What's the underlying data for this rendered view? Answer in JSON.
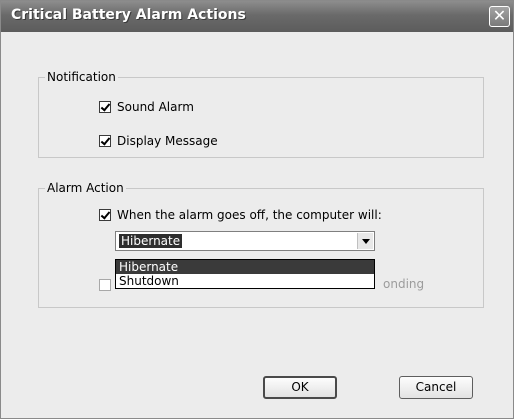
{
  "window": {
    "title": "Critical Battery Alarm Actions",
    "close_glyph": "✕"
  },
  "notification": {
    "legend": "Notification",
    "sound_alarm": {
      "label": "Sound Alarm",
      "checked": true
    },
    "display_message": {
      "label": "Display Message",
      "checked": true
    }
  },
  "alarm_action": {
    "legend": "Alarm Action",
    "run_action": {
      "label": "When the alarm goes off, the computer will:",
      "checked": true
    },
    "select_value": "Hibernate",
    "options": [
      "Hibernate",
      "Shutdown"
    ],
    "selected_option_index": 0,
    "hidden_checkbox_visible_text": "onding"
  },
  "buttons": {
    "ok": "OK",
    "cancel": "Cancel"
  }
}
